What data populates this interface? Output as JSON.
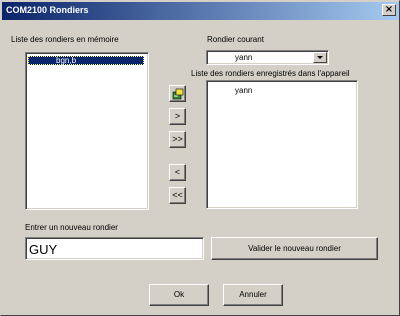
{
  "window": {
    "title": "COM2100 Rondiers",
    "close_glyph": "×"
  },
  "memory_list": {
    "label": "Liste des rondiers en mémoire",
    "items": [
      "bgn,b"
    ]
  },
  "current": {
    "label": "Rondier courant",
    "value": "yann"
  },
  "device_list": {
    "label": "Liste des rondiers enregistrés dans l'appareil",
    "items": [
      "yann"
    ]
  },
  "transfer_buttons": {
    "send_icon": "transfer-to-device-icon",
    "move_right": ">",
    "move_all_right": ">>",
    "move_left": "<",
    "move_all_left": "<<"
  },
  "new_rondier": {
    "label": "Entrer un nouveau rondier",
    "value": "GUY",
    "validate_label": "Valider le nouveau rondier"
  },
  "footer": {
    "ok_label": "Ok",
    "cancel_label": "Annuler"
  }
}
